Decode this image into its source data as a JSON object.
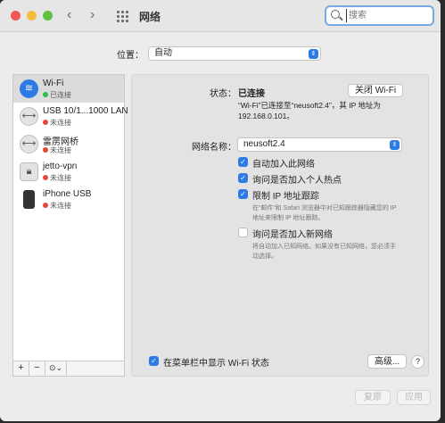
{
  "window": {
    "title": "网络"
  },
  "search": {
    "placeholder": "搜索"
  },
  "location": {
    "label": "位置：",
    "value": "自动"
  },
  "sidebar": {
    "items": [
      {
        "name": "Wi-Fi",
        "status": "已连接",
        "status_color": "#2fbf4f",
        "icon": "wifi-icon"
      },
      {
        "name": "USB 10/1...1000 LAN",
        "status": "未连接",
        "status_color": "#e5483c",
        "icon": "ethernet-icon"
      },
      {
        "name": "雷雳网桥",
        "status": "未连接",
        "status_color": "#e5483c",
        "icon": "ethernet-icon"
      },
      {
        "name": "jetto-vpn",
        "status": "未连接",
        "status_color": "#e5483c",
        "icon": "lock-icon"
      },
      {
        "name": "iPhone USB",
        "status": "未连接",
        "status_color": "#e5483c",
        "icon": "iphone-icon"
      }
    ],
    "tools": {
      "add": "+",
      "remove": "−",
      "action": "⊙⌄"
    }
  },
  "detail": {
    "status_label": "状态：",
    "status_value": "已连接",
    "toggle_button": "关闭 Wi-Fi",
    "status_desc_1": "“Wi-Fi”已连接至“neusoft2.4”，其 IP 地址为",
    "status_desc_2": "192.168.0.101。",
    "network_label": "网络名称：",
    "network_value": "neusoft2.4",
    "options": [
      {
        "label": "自动加入此网络",
        "checked": true
      },
      {
        "label": "询问是否加入个人热点",
        "checked": true
      },
      {
        "label": "限制 IP 地址跟踪",
        "checked": true
      },
      {
        "label": "询问是否加入新网络",
        "checked": false
      }
    ],
    "hint_tracking_1": "在“邮件”和 Safari 浏览器中对已知跟踪器隐藏您的 IP",
    "hint_tracking_2": "地址来限制 IP 地址跟踪。",
    "hint_new_1": "将自动加入已知网络。如果没有已知网络，您必须手",
    "hint_new_2": "动选择。",
    "show_menubar": "在菜单栏中显示 Wi-Fi 状态",
    "advanced": "高级...",
    "help": "?"
  },
  "footer": {
    "revert": "复原",
    "apply": "应用"
  },
  "colors": {
    "accent": "#2f7be5",
    "connected": "#2fbf4f",
    "disconnected": "#e5483c"
  }
}
